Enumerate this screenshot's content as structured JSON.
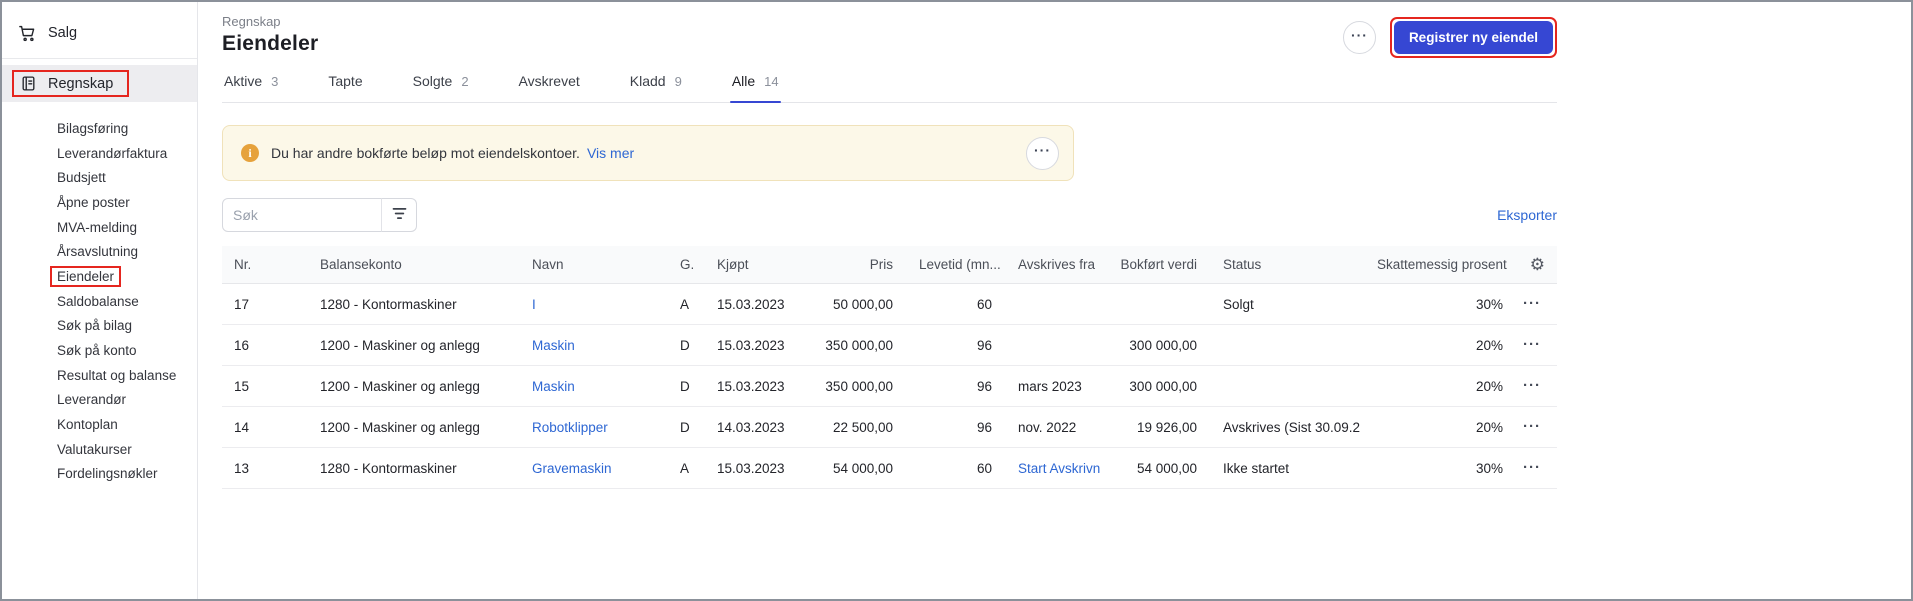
{
  "colors": {
    "primary_blue": "#3647d3",
    "link_blue": "#2e67d3",
    "annotation_red": "#e5261f",
    "alert_bg": "#fcf8e8",
    "alert_border": "#f0e2ba",
    "sidebar_active_bg": "#ededf0"
  },
  "sidebar": {
    "salg": "Salg",
    "regnskap": "Regnskap",
    "subitems": [
      "Bilagsføring",
      "Leverandørfaktura",
      "Budsjett",
      "Åpne poster",
      "MVA-melding",
      "Årsavslutning",
      "Eiendeler",
      "Saldobalanse",
      "Søk på bilag",
      "Søk på konto",
      "Resultat og balanse",
      "Leverandør",
      "Kontoplan",
      "Valutakurser",
      "Fordelingsnøkler"
    ]
  },
  "header": {
    "breadcrumb": "Regnskap",
    "title": "Eiendeler",
    "more_label": "···",
    "primary_button": "Registrer ny eiendel"
  },
  "tabs": [
    {
      "label": "Aktive",
      "count": "3"
    },
    {
      "label": "Tapte",
      "count": ""
    },
    {
      "label": "Solgte",
      "count": "2"
    },
    {
      "label": "Avskrevet",
      "count": ""
    },
    {
      "label": "Kladd",
      "count": "9"
    },
    {
      "label": "Alle",
      "count": "14"
    }
  ],
  "alert": {
    "icon_glyph": "i",
    "text": "Du har andre bokførte beløp mot eiendelskontoer.",
    "link": "Vis mer",
    "more_label": "···"
  },
  "toolbar": {
    "search_placeholder": "Søk",
    "export_label": "Eksporter"
  },
  "table": {
    "headers": [
      "Nr.",
      "Balansekonto",
      "Navn",
      "G.",
      "Kjøpt",
      "Pris",
      "Levetid (mn...",
      "Avskrives fra",
      "Bokført verdi",
      "Status",
      "Skattemessig prosent"
    ],
    "gear_icon": "⚙",
    "row_actions": "···",
    "rows": [
      [
        "17",
        "1280 - Kontormaskiner",
        "I",
        "A",
        "15.03.2023",
        "50 000,00",
        "60",
        "",
        "",
        "Solgt",
        "30%"
      ],
      [
        "16",
        "1200 - Maskiner og anlegg",
        "Maskin",
        "D",
        "15.03.2023",
        "350 000,00",
        "96",
        "",
        "300 000,00",
        "",
        "20%"
      ],
      [
        "15",
        "1200 - Maskiner og anlegg",
        "Maskin",
        "D",
        "15.03.2023",
        "350 000,00",
        "96",
        "mars 2023",
        "300 000,00",
        "",
        "20%"
      ],
      [
        "14",
        "1200 - Maskiner og anlegg",
        "Robotklipper",
        "D",
        "14.03.2023",
        "22 500,00",
        "96",
        "nov. 2022",
        "19 926,00",
        "Avskrives (Sist 30.09.2",
        "20%"
      ],
      [
        "13",
        "1280 - Kontormaskiner",
        "Gravemaskin",
        "A",
        "15.03.2023",
        "54 000,00",
        "60",
        "Start Avskrivn",
        "54 000,00",
        "Ikke startet",
        "30%"
      ]
    ]
  }
}
